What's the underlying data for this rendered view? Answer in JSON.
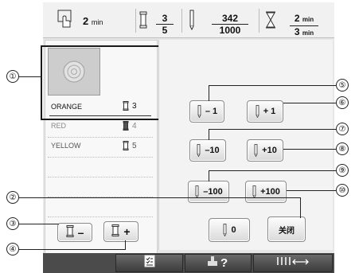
{
  "status": {
    "time_value": "2",
    "time_unit": "min",
    "color_current": "3",
    "color_total": "5",
    "stitch_current": "342",
    "stitch_total": "1000",
    "time_elapsed_value": "2",
    "time_elapsed_unit": "min",
    "time_total_value": "3",
    "time_total_unit": "min"
  },
  "thread_list": [
    {
      "name": "ORANGE",
      "order": "3",
      "swatch": "#ffffff"
    },
    {
      "name": "RED",
      "order": "4",
      "swatch": "#555555"
    },
    {
      "name": "YELLOW",
      "order": "5",
      "swatch": "#ffffff"
    }
  ],
  "buttons": {
    "minus1": "– 1",
    "plus1": "+ 1",
    "minus10": "–10",
    "plus10": "+10",
    "minus100": "–100",
    "plus100": "+100",
    "zero": "0",
    "close": "关闭"
  },
  "callouts": [
    "①",
    "②",
    "③",
    "④",
    "⑤",
    "⑥",
    "⑦",
    "⑧",
    "⑨",
    "⑩"
  ],
  "icons": {
    "hand": "hand-icon",
    "spool": "spool-icon",
    "needle": "needle-icon",
    "hourglass": "hourglass-icon",
    "checklist": "checklist-icon",
    "help": "help-icon",
    "stitch_width": "stitch-width-icon"
  }
}
